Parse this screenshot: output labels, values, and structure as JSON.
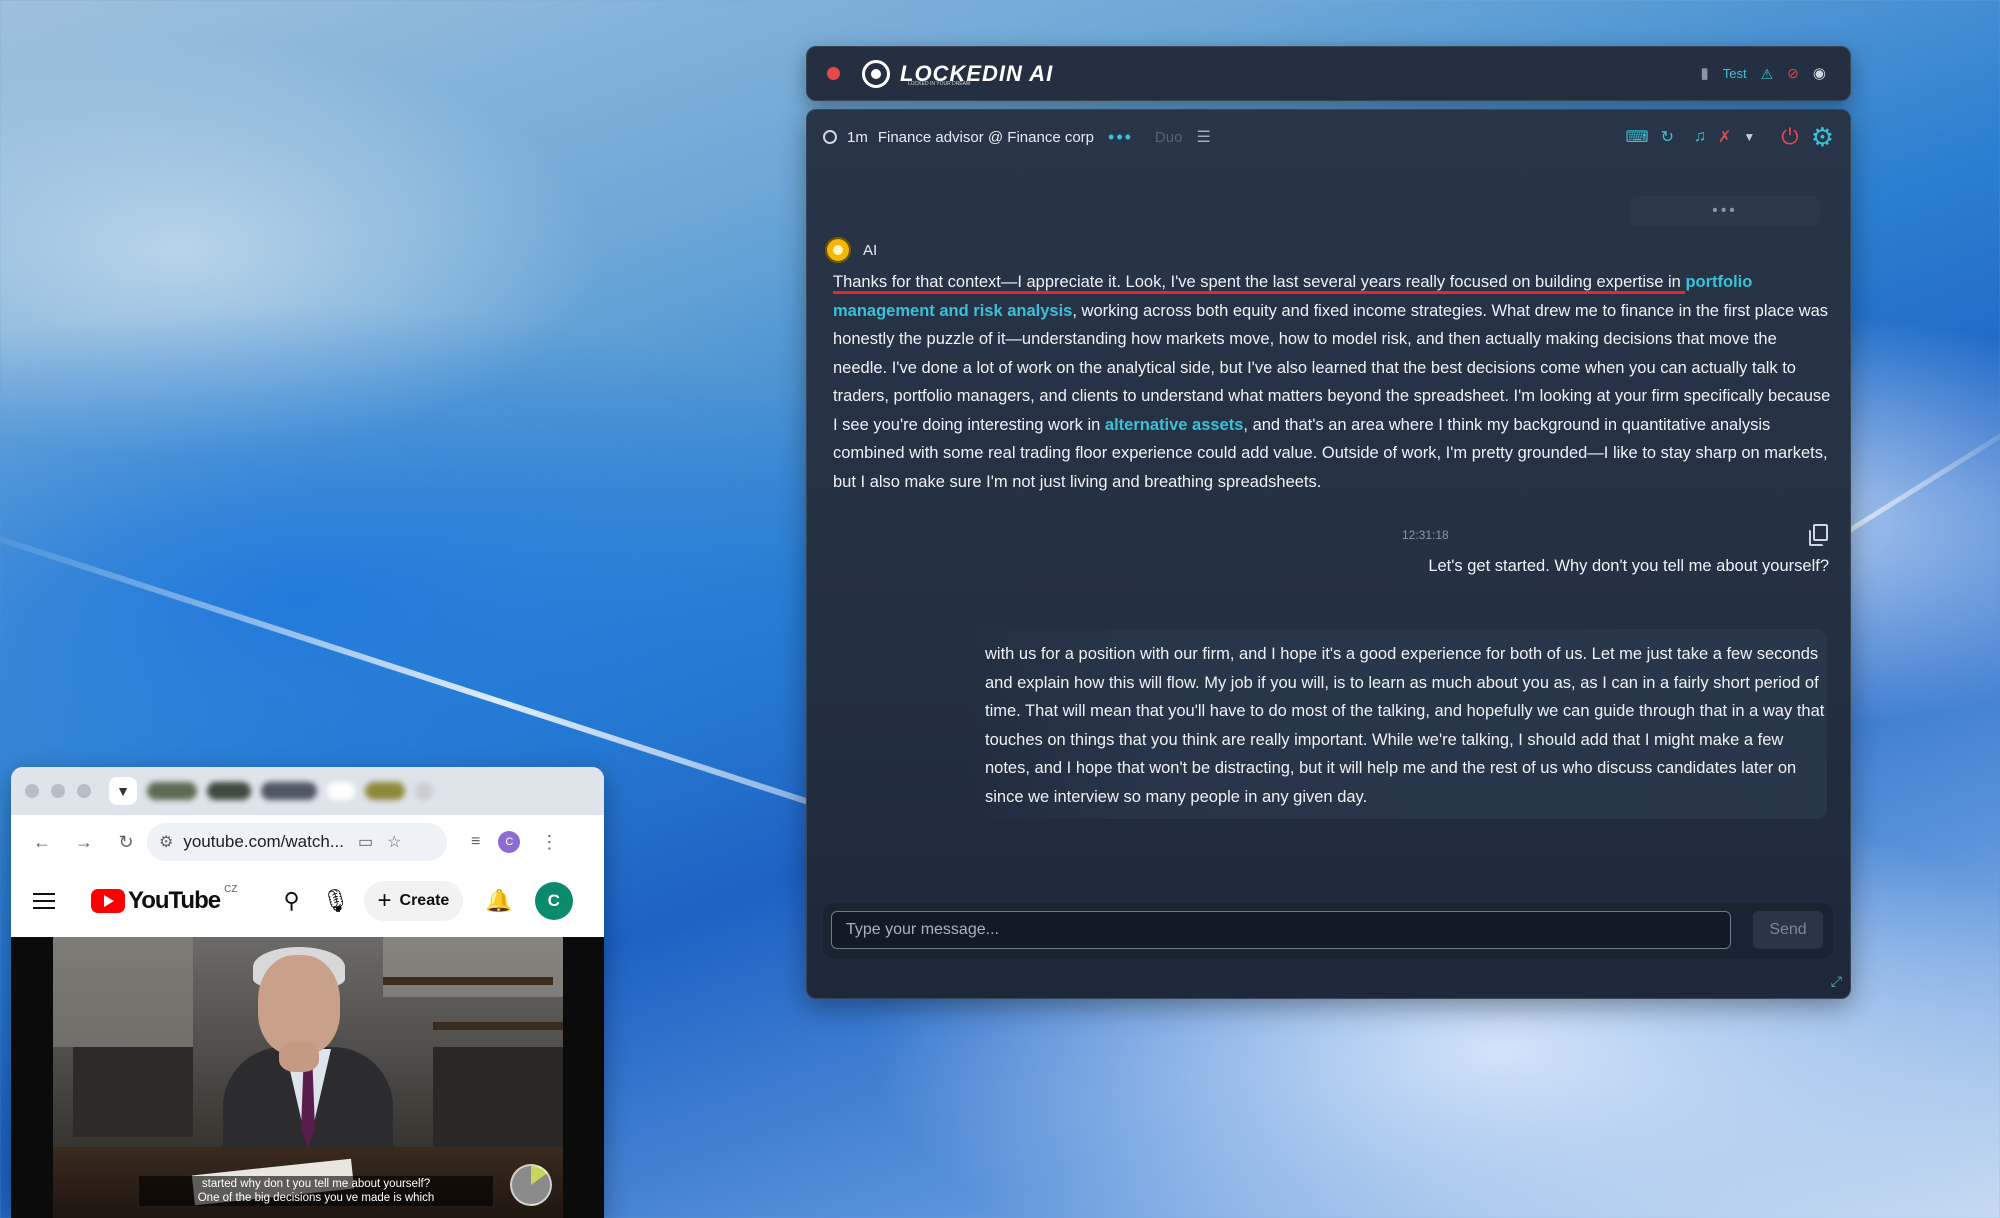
{
  "app": {
    "title": "LOCKEDIN AI",
    "subtitle": "LOCKED IN YOUR DREAM",
    "top_right": {
      "test_label": "Test"
    },
    "toolbar": {
      "duration": "1m",
      "session": "Finance advisor @ Finance corp",
      "duo": "Duo"
    },
    "ai_label": "AI",
    "ai_message": {
      "p1": "Thanks for that context—I appreciate it. Look, I've spent the last several years really focused on building expertise in ",
      "h1": "portfolio management and risk analysis",
      "p2": ", working across both equity and fixed income strategies. What drew me to finance in the first place was honestly the puzzle of it—understanding how markets move, how to model risk, and then actually making decisions that move the needle. I've done a lot of work on the analytical side, but I've also learned that the best decisions come when you can actually talk to traders, portfolio managers, and clients to understand what matters beyond the spreadsheet. I'm looking at your firm specifically because I see you're doing interesting work in ",
      "h2": "alternative assets",
      "p3": ", and that's an area where I think my background in quantitative analysis combined with some real trading floor experience could add value. Outside of work, I'm pretty grounded—I like to stay sharp on markets, but I also make sure I'm not just living and breathing spreadsheets."
    },
    "user_timestamp": "12:31:18",
    "user_message": "Let's get started. Why don't you tell me about yourself?",
    "interviewer_message": "with us for a position with our firm, and I hope it's a good experience for both of us. Let me just take a few seconds and explain how this will flow. My job if you will, is to learn as much about you as, as I can in a fairly short period of time. That will mean that you'll have to do most of the talking, and hopefully we can guide through that in a way that touches on things that you think are really important. While we're talking, I should add that I might make a few notes, and I hope that won't be distracting, but it will help me and the rest of us who discuss candidates later on since we interview so many people in any given day.",
    "input": {
      "placeholder": "Type your message...",
      "value": ""
    },
    "send_label": "Send",
    "colors": {
      "accent": "#3bc0d6",
      "danger": "#e5484d",
      "panel": "#243041"
    }
  },
  "browser": {
    "url": "youtube.com/watch...",
    "profile_initial": "C",
    "youtube": {
      "logo": "YouTube",
      "region": "CZ",
      "create_label": "Create",
      "avatar_initial": "C"
    },
    "video": {
      "subtitle_line1": "started why don t you tell me about yourself?",
      "subtitle_line2": "One of the big decisions you ve made is which",
      "progress_percent": 15
    },
    "icons": [
      "back-arrow-icon",
      "forward-arrow-icon",
      "reload-icon",
      "site-settings-icon",
      "install-icon",
      "star-icon",
      "reading-list-icon",
      "more-vert-icon"
    ]
  }
}
